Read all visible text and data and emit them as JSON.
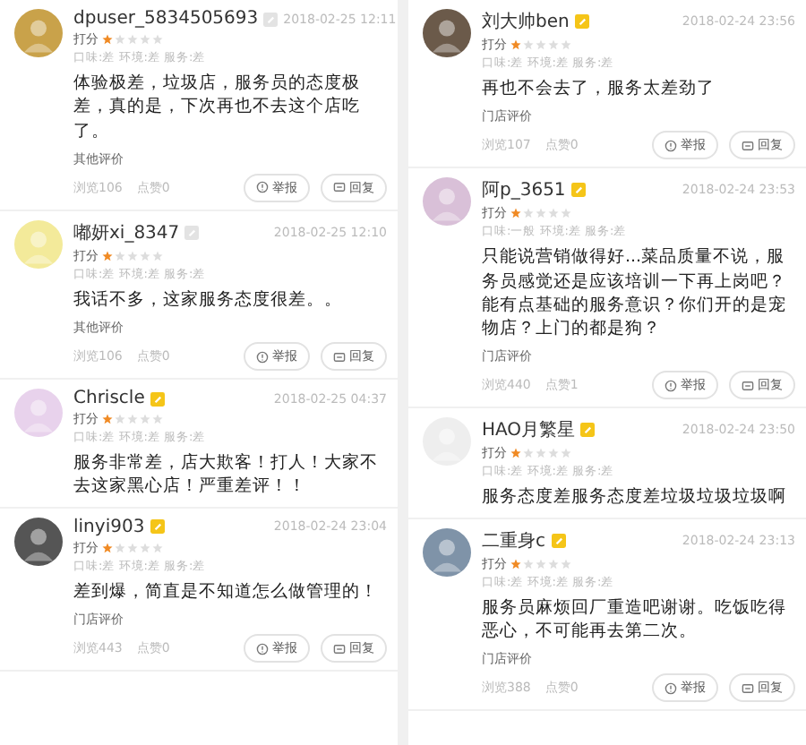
{
  "columns": [
    {
      "reviews": [
        {
          "user": "dpuser_5834505693",
          "vip": false,
          "time": "2018-02-25 12:11",
          "score_label": "打分",
          "stars": 1,
          "aspects": "口味:差 环境:差 服务:差",
          "content": "体验极差，垃圾店，服务员的态度极差，真的是，下次再也不去这个店吃了。",
          "source": "其他评价",
          "views": "浏览106",
          "likes": "点赞0",
          "report": "举报",
          "reply": "回复"
        },
        {
          "user": "嘟妍xi_8347",
          "vip": false,
          "time": "2018-02-25 12:10",
          "score_label": "打分",
          "stars": 1,
          "aspects": "口味:差 环境:差 服务:差",
          "content": "我话不多，这家服务态度很差。。",
          "source": "其他评价",
          "views": "浏览106",
          "likes": "点赞0",
          "report": "举报",
          "reply": "回复"
        },
        {
          "user": "Chriscle",
          "vip": true,
          "time": "2018-02-25 04:37",
          "score_label": "打分",
          "stars": 1,
          "aspects": "口味:差 环境:差 服务:差",
          "content": "服务非常差，店大欺客！打人！大家不去这家黑心店！严重差评！！"
        },
        {
          "user": "linyi903",
          "vip": true,
          "time": "2018-02-24 23:04",
          "score_label": "打分",
          "stars": 1,
          "aspects": "口味:差 环境:差 服务:差",
          "content": "差到爆，简直是不知道怎么做管理的！",
          "source": "门店评价",
          "views": "浏览443",
          "likes": "点赞0",
          "report": "举报",
          "reply": "回复"
        }
      ]
    },
    {
      "reviews": [
        {
          "user": "刘大帅ben",
          "vip": true,
          "time": "2018-02-24 23:56",
          "score_label": "打分",
          "stars": 1,
          "aspects": "口味:差 环境:差 服务:差",
          "content": "再也不会去了，服务太差劲了",
          "source": "门店评价",
          "views": "浏览107",
          "likes": "点赞0",
          "report": "举报",
          "reply": "回复"
        },
        {
          "user": "阿p_3651",
          "vip": true,
          "time": "2018-02-24 23:53",
          "score_label": "打分",
          "stars": 1,
          "aspects": "口味:一般 环境:差 服务:差",
          "content": "只能说营销做得好...菜品质量不说，服务员感觉还是应该培训一下再上岗吧？能有点基础的服务意识？你们开的是宠物店？上门的都是狗？",
          "source": "门店评价",
          "views": "浏览440",
          "likes": "点赞1",
          "report": "举报",
          "reply": "回复"
        },
        {
          "user": "HAO月繁星",
          "vip": true,
          "time": "2018-02-24 23:50",
          "score_label": "打分",
          "stars": 1,
          "aspects": "口味:差 环境:差 服务:差",
          "content": "服务态度差服务态度差垃圾垃圾垃圾啊"
        },
        {
          "user": "二重身c",
          "vip": true,
          "time": "2018-02-24 23:13",
          "score_label": "打分",
          "stars": 1,
          "aspects": "口味:差 环境:差 服务:差",
          "content": "服务员麻烦回厂重造吧谢谢。吃饭吃得恶心，不可能再去第二次。",
          "source": "门店评价",
          "views": "浏览388",
          "likes": "点赞0",
          "report": "举报",
          "reply": "回复"
        }
      ]
    }
  ]
}
